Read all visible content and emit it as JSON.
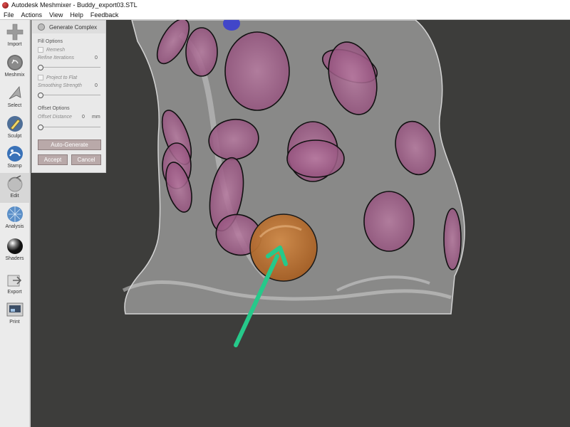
{
  "window": {
    "title": "Autodesk Meshmixer - Buddy_export03.STL"
  },
  "menu": [
    "File",
    "Actions",
    "View",
    "Help",
    "Feedback"
  ],
  "tools": [
    {
      "label": "Import",
      "icon": "plus-icon"
    },
    {
      "label": "Meshmix",
      "icon": "meshmix-icon"
    },
    {
      "label": "Select",
      "icon": "select-cursor-icon"
    },
    {
      "label": "Sculpt",
      "icon": "sculpt-brush-icon"
    },
    {
      "label": "Stamp",
      "icon": "stamp-icon"
    },
    {
      "label": "Edit",
      "icon": "edit-icon"
    },
    {
      "label": "Analysis",
      "icon": "analysis-icon"
    },
    {
      "label": "Shaders",
      "icon": "shaders-sphere-icon"
    },
    {
      "label": "Export",
      "icon": "export-icon"
    },
    {
      "label": "Print",
      "icon": "print-icon"
    }
  ],
  "active_tool": "Edit",
  "panel": {
    "title": "Generate Complex",
    "fill_options": "Fill Options",
    "remesh": "Remesh",
    "refine_iterations": {
      "label": "Refine Iterations",
      "value": "0"
    },
    "project_to_flat": "Project to Flat",
    "smoothing_strength": {
      "label": "Smoothing Strength",
      "value": "0"
    },
    "offset_options": "Offset Options",
    "offset_distance": {
      "label": "Offset Distance",
      "value": "0",
      "unit": "mm"
    },
    "auto_generate": "Auto-Generate",
    "accept": "Accept",
    "cancel": "Cancel"
  },
  "colors": {
    "viewport_bg": "#3d3d3b",
    "highlight_patch": "#c07a3c",
    "arrow": "#26c98a",
    "button": "#b9a9a9"
  }
}
